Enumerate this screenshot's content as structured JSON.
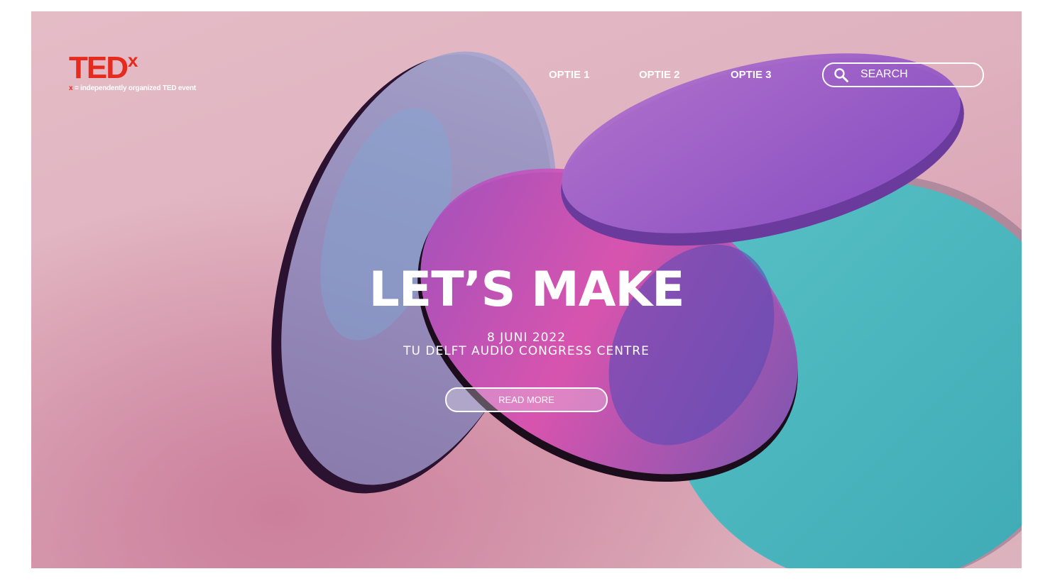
{
  "logo": {
    "brand": "TED",
    "superscript": "x",
    "tagline_x": "x",
    "tagline": " = independently organized TED event"
  },
  "nav": {
    "items": [
      {
        "label": "OPTIE 1"
      },
      {
        "label": "OPTIE 2"
      },
      {
        "label": "OPTIE 3"
      }
    ]
  },
  "search": {
    "placeholder": "SEARCH"
  },
  "hero": {
    "headline": "LET’S MAKE",
    "date": "8 JUNI 2022",
    "venue": "TU DELFT AUDIO CONGRESS CENTRE",
    "cta_label": "READ MORE"
  },
  "colors": {
    "brand_red": "#e62b1e",
    "background_pink": "#e0b2c0",
    "disc_purple": "#9b5fc6",
    "disc_magenta": "#d74cb6",
    "disc_teal": "#4bbfc4",
    "disc_lilac": "#9fa0c9"
  }
}
